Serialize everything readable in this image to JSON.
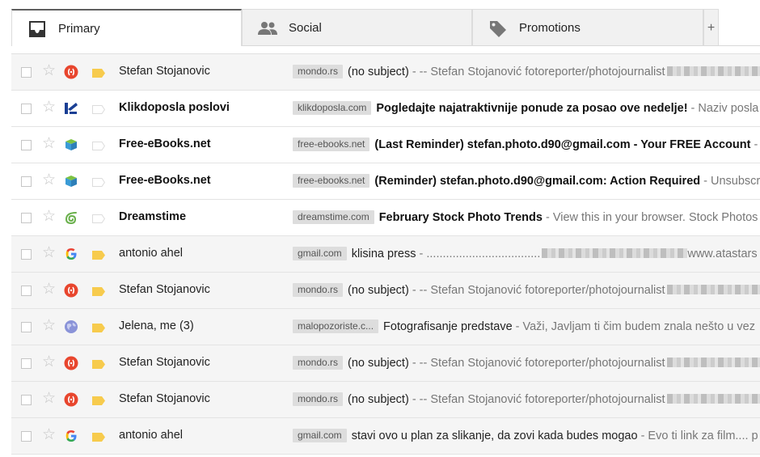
{
  "tabs": [
    {
      "label": "Primary",
      "icon": "inbox-icon",
      "active": true
    },
    {
      "label": "Social",
      "icon": "people-icon",
      "active": false
    },
    {
      "label": "Promotions",
      "icon": "tag-icon",
      "active": false
    }
  ],
  "add_tab_label": "+",
  "emails": [
    {
      "sender": "Stefan Stojanovic",
      "chip": "mondo.rs",
      "subject": "(no subject)",
      "snippet": " - -- Stefan Stojanović fotoreporter/photojournalist",
      "blurred": true,
      "snippet_tail": "",
      "unread": false,
      "sender_icon": "orange-circle-icon",
      "important": true
    },
    {
      "sender": "Klikdoposla poslovi",
      "chip": "klikdoposla.com",
      "subject": "Pogledajte najatraktivnije ponude za posao ove nedelje!",
      "snippet": " - Naziv posla",
      "blurred": false,
      "snippet_tail": "",
      "unread": true,
      "sender_icon": "klikdoposla-logo-icon",
      "important": false
    },
    {
      "sender": "Free-eBooks.net",
      "chip": "free-ebooks.net",
      "subject": "(Last Reminder) stefan.photo.d90@gmail.com - Your FREE Account",
      "snippet": " - ",
      "blurred": false,
      "snippet_tail": "",
      "unread": true,
      "sender_icon": "free-ebooks-logo-icon",
      "important": false
    },
    {
      "sender": "Free-eBooks.net",
      "chip": "free-ebooks.net",
      "subject": "(Reminder) stefan.photo.d90@gmail.com: Action Required",
      "snippet": " - Unsubscri",
      "blurred": false,
      "snippet_tail": "",
      "unread": true,
      "sender_icon": "free-ebooks-logo-icon",
      "important": false
    },
    {
      "sender": "Dreamstime",
      "chip": "dreamstime.com",
      "subject": "February Stock Photo Trends",
      "snippet": " - View this in your browser. Stock Photos",
      "blurred": false,
      "snippet_tail": "",
      "unread": true,
      "sender_icon": "dreamstime-logo-icon",
      "important": false
    },
    {
      "sender": "antonio ahel",
      "chip": "gmail.com",
      "subject": "klisina press",
      "snippet": " - ...................................",
      "blurred": true,
      "snippet_tail": "www.atastars",
      "unread": false,
      "sender_icon": "google-g-icon",
      "important": true
    },
    {
      "sender": "Stefan Stojanovic",
      "chip": "mondo.rs",
      "subject": "(no subject)",
      "snippet": " - -- Stefan Stojanović fotoreporter/photojournalist",
      "blurred": true,
      "snippet_tail": "",
      "unread": false,
      "sender_icon": "orange-circle-icon",
      "important": true
    },
    {
      "sender": "Jelena, me (3)",
      "chip": "malopozoriste.c...",
      "subject": "Fotografisanje predstave",
      "snippet": " - Važi, Javljam ti čim budem znala nešto u vez",
      "blurred": false,
      "snippet_tail": "",
      "unread": false,
      "sender_icon": "globe-icon",
      "important": true
    },
    {
      "sender": "Stefan Stojanovic",
      "chip": "mondo.rs",
      "subject": "(no subject)",
      "snippet": " - -- Stefan Stojanović fotoreporter/photojournalist",
      "blurred": true,
      "snippet_tail": "",
      "unread": false,
      "sender_icon": "orange-circle-icon",
      "important": true
    },
    {
      "sender": "Stefan Stojanovic",
      "chip": "mondo.rs",
      "subject": "(no subject)",
      "snippet": " - -- Stefan Stojanović fotoreporter/photojournalist",
      "blurred": true,
      "snippet_tail": "",
      "unread": false,
      "sender_icon": "orange-circle-icon",
      "important": true
    },
    {
      "sender": "antonio ahel",
      "chip": "gmail.com",
      "subject": "stavi ovo u plan za slikanje, da zovi kada budes mogao",
      "snippet": " - Evo ti link za film.... p",
      "blurred": false,
      "snippet_tail": "",
      "unread": false,
      "sender_icon": "google-g-icon",
      "important": true
    }
  ],
  "colors": {
    "important_flag": "#f7cb4d",
    "unread_bg": "#ffffff",
    "read_bg": "#f5f5f5"
  }
}
